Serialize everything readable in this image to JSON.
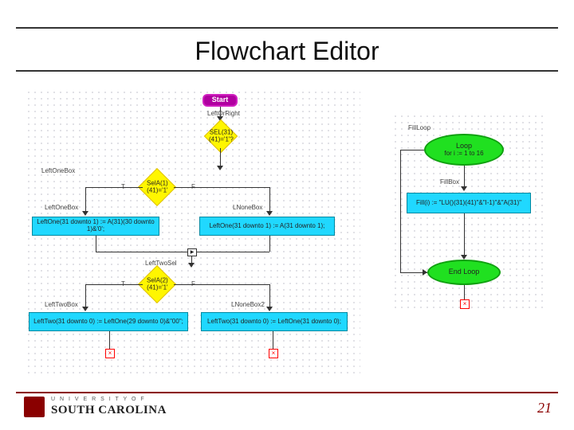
{
  "slide": {
    "title": "Flowchart Editor",
    "page_number": "21"
  },
  "logo": {
    "line1": "U N I V E R S I T Y   O F",
    "line2": "SOUTH CAROLINA"
  },
  "flow": {
    "start": "Start",
    "lbl_leftright": "LeftOrRight",
    "d1": "SEL(31)(41)='1'?",
    "lbl_leftonebox": "LeftOneBox",
    "d2": "SelA(1)(41)='1'",
    "lbl_t1": "T",
    "lbl_f1": "F",
    "lbl_leftonebox2": "LeftOneBox",
    "p_leftone": "LeftOne(31 downto 1) := A(31)(30 downto 1)&'0';",
    "lbl_lnonebox": "LNoneBox",
    "p_lnone": "LeftOne(31 downto 1) := A(31 downto 1);",
    "lbl_lefttwosel": "LeftTwoSel",
    "d3": "SelA(2)(41)='1'",
    "lbl_t2": "T",
    "lbl_f2": "F",
    "lbl_lefttwobox": "LeftTwoBox",
    "p_lefttwo": "LeftTwo(31 downto 0) := LeftOne(29 downto 0)&\"00\";",
    "lbl_lnonebox2": "LNoneBox2",
    "p_lnone2": "LeftTwo(31 downto 0) := LeftOne(31 downto 0);",
    "lbl_fillloop": "FillLoop",
    "loop": "Loop",
    "loop_sub": "for i := 1 to 16",
    "lbl_fillbox": "FillBox",
    "p_fill": "Fill(i) := \"LU()(31)(41)\"&\"I-1)\"&\"A(31)\"",
    "endloop": "End Loop"
  }
}
